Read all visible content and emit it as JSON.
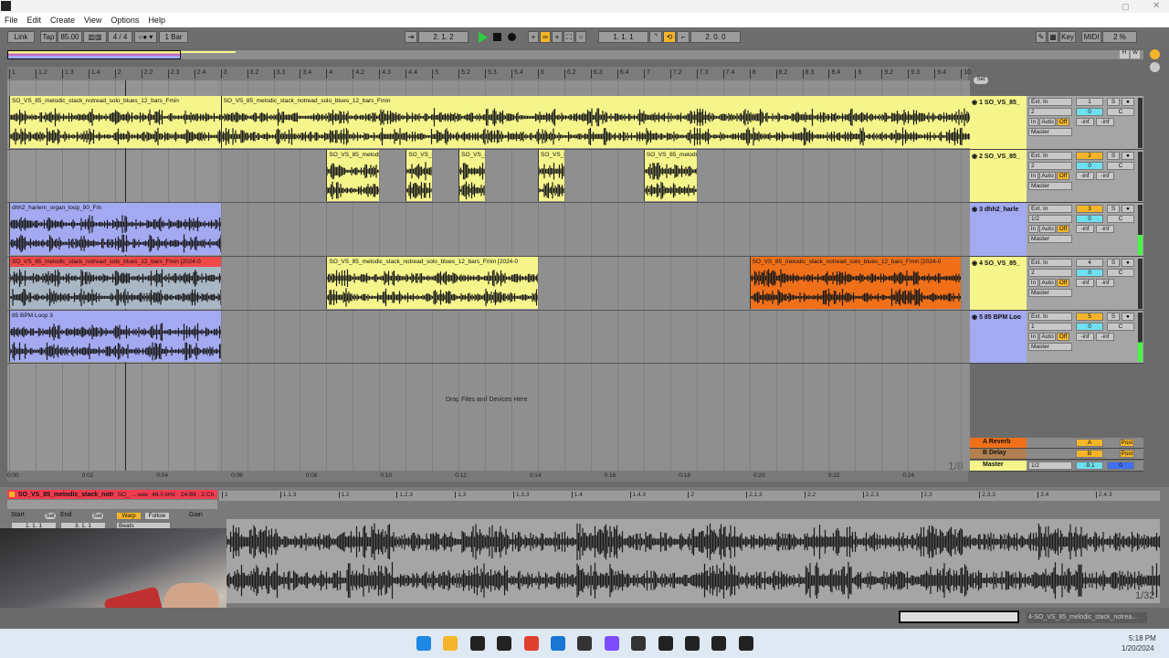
{
  "window": {
    "app_icon": "Live"
  },
  "menu": [
    "File",
    "Edit",
    "Create",
    "View",
    "Options",
    "Help"
  ],
  "toolbar": {
    "link": "Link",
    "tap": "Tap",
    "tempo": "85.00",
    "signature": "4 / 4",
    "quantize": "1 Bar",
    "arrangement_position": "2.  1.  2",
    "loop_start": "1.  1.  1",
    "loop_length": "2.  0.  0",
    "key": "Key",
    "midi": "MIDI",
    "cpu": "2 %",
    "loop_enabled": true,
    "play_color": "#2ecc40"
  },
  "ruler": {
    "bars": [
      "1",
      "1.2",
      "1.3",
      "1.4",
      "2",
      "2.2",
      "2.3",
      "2.4",
      "3",
      "3.2",
      "3.3",
      "3.4",
      "4",
      "4.2",
      "4.3",
      "4.4",
      "5",
      "5.2",
      "5.3",
      "5.4",
      "6",
      "6.2",
      "6.3",
      "6.4",
      "7",
      "7.2",
      "7.3",
      "7.4",
      "8",
      "8.2",
      "8.3",
      "8.4",
      "9",
      "9.2",
      "9.3",
      "9.4",
      "10"
    ],
    "set": "Set",
    "h": "H",
    "w": "W"
  },
  "tracks": [
    {
      "num": "1",
      "name": "1 SO_VS_85_",
      "color": "#f5f58c",
      "input": "Ext. In",
      "channel": "2",
      "output": "Master",
      "volume": "0",
      "pan": "C",
      "peak_l": "-inf",
      "peak_r": "-inf",
      "armed": false,
      "clips": [
        {
          "name": "SO_VS_85_melodic_stack_notread_solo_blues_12_bars_Fmin",
          "start": 1,
          "end": 3,
          "color": "#f5f58c"
        },
        {
          "name": "SO_VS_85_melodic_stack_notread_solo_blues_12_bars_Fmin",
          "start": 3,
          "end": 10.1,
          "color": "#f5f58c"
        }
      ]
    },
    {
      "num": "2",
      "name": "2 SO_VS_85_",
      "color": "#f5f58c",
      "input": "Ext. In",
      "channel": "2",
      "output": "Master",
      "volume": "0",
      "pan": "C",
      "peak_l": "-inf",
      "peak_r": "-inf",
      "armed": true,
      "clips": [
        {
          "name": "SO_VS_85_melodic",
          "start": 4,
          "end": 4.5
        },
        {
          "name": "SO_VS_85_melodic",
          "start": 4.75,
          "end": 5
        },
        {
          "name": "SO_VS_85_melodic",
          "start": 5.25,
          "end": 5.5
        },
        {
          "name": "SO_VS_85_melodic",
          "start": 6,
          "end": 6.25
        },
        {
          "name": "SO_VS_85_melodic",
          "start": 7,
          "end": 7.5
        }
      ]
    },
    {
      "num": "3",
      "name": "3 dhh2_harle",
      "color": "#a3aaf2",
      "input": "Ext. In",
      "channel": "1/2",
      "output": "Master",
      "volume": "0",
      "pan": "C",
      "peak_l": "-inf",
      "peak_r": "-inf",
      "armed": true,
      "clips": [
        {
          "name": "dhh2_harlem_organ_loop_90_Fm",
          "start": 1,
          "end": 3,
          "color": "#a3aaf2"
        }
      ]
    },
    {
      "num": "4",
      "name": "4 SO_VS_85_",
      "color": "#f5f58c",
      "input": "Ext. In",
      "channel": "2",
      "output": "Master",
      "volume": "0",
      "pan": "C",
      "peak_l": "-inf",
      "peak_r": "-inf",
      "armed": false,
      "clips": [
        {
          "name": "SO_VS_85_melodic_stack_notread_solo_blues_12_bars_Fmin [2024-0",
          "start": 1,
          "end": 3,
          "color": "#a9b6c4",
          "header": "#f04848"
        },
        {
          "name": "SO_VS_85_melodic_stack_notread_solo_blues_12_bars_Fmin [2024-0",
          "start": 4,
          "end": 6,
          "color": "#f5f58c"
        },
        {
          "name": "SO_VS_85_melodic_stack_notread_solo_blues_12_bars_Fmin [2024-0",
          "start": 8,
          "end": 10,
          "color": "#f0701a"
        }
      ]
    },
    {
      "num": "5",
      "name": "5 85 BPM Loo",
      "color": "#a3aaf2",
      "input": "Ext. In",
      "channel": "1",
      "output": "Master",
      "volume": "0",
      "pan": "C",
      "peak_l": "-inf",
      "peak_r": "-inf",
      "armed": true,
      "clips": [
        {
          "name": "85 BPM Loop 3",
          "start": 1,
          "end": 3,
          "color": "#a3aaf2"
        }
      ]
    }
  ],
  "drop_hint": "Drop Files and Devices Here",
  "returns": [
    {
      "name": "A Reverb",
      "letter": "A",
      "color": "#f0701a",
      "post": "Post"
    },
    {
      "name": "B Delay",
      "letter": "B",
      "color": "#b08050",
      "post": "Post"
    }
  ],
  "master": {
    "name": "Master",
    "channel": "1/2",
    "volume": "-9.1",
    "pan": "0"
  },
  "grid_fraction": "1/8",
  "time_ruler": [
    "0:00",
    "0:02",
    "0:04",
    "0:06",
    "0:08",
    "0:10",
    "0:12",
    "0:14",
    "0:16",
    "0:18",
    "0:20",
    "0:22",
    "0:24"
  ],
  "detail": {
    "clip_name": "SO_VS_85_melodic_stack_notr",
    "file": "SO_ ....wav",
    "format": "48.0 kHz · 24-Bit · 2 Ch",
    "start_label": "Start",
    "end_label": "End",
    "set": "Set",
    "start": "1.  1.  1",
    "end": "3.  1.  1",
    "warp": "Warp",
    "follow": "Follow",
    "warp_mode": "Beats",
    "gain": "Gain",
    "ruler": [
      "1",
      "1.1.3",
      "1.2",
      "1.2.3",
      "1.3",
      "1.3.3",
      "1.4",
      "1.4.3",
      "2",
      "2.1.3",
      "2.2",
      "2.2.3",
      "2.3",
      "2.3.3",
      "2.4",
      "2.4.3"
    ],
    "zoom": "1/32"
  },
  "status": {
    "selected": "4-SO_VS_85_melodic_stack_notrea..."
  },
  "taskbar": {
    "time": "5:18 PM",
    "date": "1/20/2024",
    "icons": [
      "windows-start",
      "file-explorer",
      "ableton-live",
      "live-2",
      "chrome",
      "app-blue",
      "app-dark",
      "app-purple",
      "app-dark-2",
      "app-record",
      "capcut",
      "app-face",
      "ableton-live-3"
    ]
  }
}
